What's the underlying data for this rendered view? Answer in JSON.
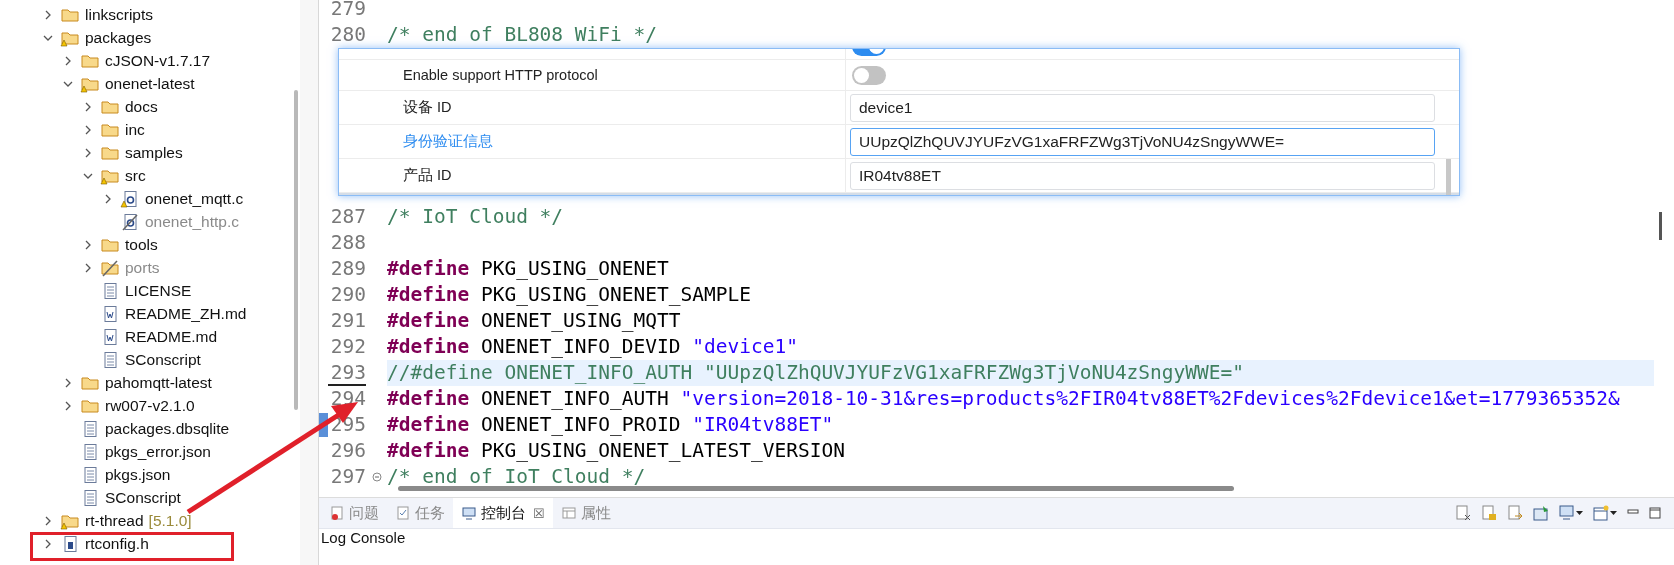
{
  "tree": [
    {
      "label": "linkscripts",
      "kind": "folder",
      "expanded": false,
      "warning": false,
      "excluded": false
    },
    {
      "label": "packages",
      "kind": "folder",
      "expanded": true,
      "warning": true,
      "excluded": false,
      "children": [
        {
          "label": "cJSON-v1.7.17",
          "kind": "folder",
          "expanded": false,
          "warning": false,
          "excluded": false
        },
        {
          "label": "onenet-latest",
          "kind": "folder",
          "expanded": true,
          "warning": true,
          "excluded": false,
          "children": [
            {
              "label": "docs",
              "kind": "folder",
              "expanded": false,
              "warning": false,
              "excluded": false
            },
            {
              "label": "inc",
              "kind": "folder",
              "expanded": false,
              "warning": false,
              "excluded": false
            },
            {
              "label": "samples",
              "kind": "folder",
              "expanded": false,
              "warning": false,
              "excluded": false
            },
            {
              "label": "src",
              "kind": "folder",
              "expanded": true,
              "warning": true,
              "excluded": false,
              "children": [
                {
                  "label": "onenet_mqtt.c",
                  "kind": "c",
                  "expanded": false,
                  "warning": true,
                  "excluded": false
                },
                {
                  "label": "onenet_http.c",
                  "kind": "c",
                  "warning": false,
                  "excluded": true
                }
              ]
            },
            {
              "label": "tools",
              "kind": "folder",
              "expanded": false,
              "warning": false,
              "excluded": false
            },
            {
              "label": "ports",
              "kind": "folder",
              "expanded": false,
              "warning": false,
              "excluded": true
            },
            {
              "label": "LICENSE",
              "kind": "file",
              "warning": false,
              "excluded": false
            },
            {
              "label": "README_ZH.md",
              "kind": "word",
              "warning": false,
              "excluded": false
            },
            {
              "label": "README.md",
              "kind": "word",
              "warning": false,
              "excluded": false
            },
            {
              "label": "SConscript",
              "kind": "file",
              "warning": false,
              "excluded": false
            }
          ]
        },
        {
          "label": "pahomqtt-latest",
          "kind": "folder",
          "expanded": false,
          "warning": false,
          "excluded": false
        },
        {
          "label": "rw007-v2.1.0",
          "kind": "folder",
          "expanded": false,
          "warning": false,
          "excluded": false
        },
        {
          "label": "packages.dbsqlite",
          "kind": "file",
          "warning": false,
          "excluded": false
        },
        {
          "label": "pkgs_error.json",
          "kind": "file",
          "warning": false,
          "excluded": false
        },
        {
          "label": "pkgs.json",
          "kind": "file",
          "warning": false,
          "excluded": false
        },
        {
          "label": "SConscript",
          "kind": "file",
          "warning": false,
          "excluded": false
        }
      ]
    },
    {
      "label": "rt-thread",
      "suffix": "[5.1.0]",
      "kind": "folder",
      "expanded": false,
      "warning": true,
      "excluded": false
    },
    {
      "label": "rtconfig.h",
      "kind": "h",
      "expanded": false,
      "warning": false,
      "excluded": false
    }
  ],
  "editor": {
    "lines_above": [
      {
        "number": "279",
        "current": false,
        "fold": false,
        "marker": false
      },
      {
        "number": "280",
        "current": false,
        "fold": false,
        "marker": false,
        "segments": [
          {
            "kind": "comment",
            "text": "/* end of BL808 WiFi */"
          }
        ]
      }
    ],
    "lines_below": [
      {
        "number": "287",
        "current": false,
        "fold": false,
        "marker": false,
        "segments": [
          {
            "kind": "comment",
            "text": "/* IoT Cloud */"
          }
        ]
      },
      {
        "number": "288",
        "current": false,
        "fold": false,
        "marker": false
      },
      {
        "number": "289",
        "current": false,
        "fold": false,
        "marker": false,
        "segments": [
          {
            "kind": "keyword",
            "text": "#define"
          },
          {
            "kind": "plain",
            "text": " PKG_USING_ONENET"
          }
        ]
      },
      {
        "number": "290",
        "current": false,
        "fold": false,
        "marker": false,
        "segments": [
          {
            "kind": "keyword",
            "text": "#define"
          },
          {
            "kind": "plain",
            "text": " PKG_USING_ONENET_SAMPLE"
          }
        ]
      },
      {
        "number": "291",
        "current": false,
        "fold": false,
        "marker": false,
        "segments": [
          {
            "kind": "keyword",
            "text": "#define"
          },
          {
            "kind": "plain",
            "text": " ONENET_USING_MQTT"
          }
        ]
      },
      {
        "number": "292",
        "current": false,
        "fold": false,
        "marker": false,
        "segments": [
          {
            "kind": "keyword",
            "text": "#define"
          },
          {
            "kind": "plain",
            "text": " ONENET_INFO_DEVID "
          },
          {
            "kind": "string",
            "text": "\"device1\""
          }
        ]
      },
      {
        "number": "293",
        "current": true,
        "fold": false,
        "marker": false,
        "segments": [
          {
            "kind": "comment",
            "text": "//#define ONENET_INFO_AUTH \"UUpzQlZhQUVJYUFzVG1xaFRFZWg3TjVoNU4zSngyWWE=\""
          }
        ]
      },
      {
        "number": "294",
        "current": false,
        "fold": false,
        "marker": false,
        "segments": [
          {
            "kind": "keyword",
            "text": "#define"
          },
          {
            "kind": "plain",
            "text": " ONENET_INFO_AUTH "
          },
          {
            "kind": "string",
            "text": "\"version=2018-10-31&res=products%2FIR04tv88ET%2Fdevices%2Fdevice1&et=1779365352&"
          }
        ]
      },
      {
        "number": "295",
        "current": false,
        "fold": false,
        "marker": true,
        "segments": [
          {
            "kind": "keyword",
            "text": "#define"
          },
          {
            "kind": "plain",
            "text": " ONENET_INFO_PROID "
          },
          {
            "kind": "string",
            "text": "\"IR04tv88ET\""
          }
        ]
      },
      {
        "number": "296",
        "current": false,
        "fold": false,
        "marker": false,
        "segments": [
          {
            "kind": "keyword",
            "text": "#define"
          },
          {
            "kind": "plain",
            "text": " PKG_USING_ONENET_LATEST_VERSION"
          }
        ]
      },
      {
        "number": "297",
        "current": false,
        "fold": true,
        "marker": false,
        "segments": [
          {
            "kind": "comment",
            "text": "/* end of IoT Cloud */"
          }
        ]
      }
    ]
  },
  "settings_popup": {
    "rows": [
      {
        "kind": "toggle",
        "on": true
      },
      {
        "kind": "toggle",
        "label": "Enable support HTTP protocol",
        "on": false
      },
      {
        "kind": "input",
        "label": "设备 ID",
        "value": "device1",
        "focused": false
      },
      {
        "kind": "input",
        "label": "身份验证信息",
        "value": "UUpzQlZhQUVJYUFzVG1xaFRFZWg3TjVoNU4zSngyWWE=",
        "focused": true
      },
      {
        "kind": "input",
        "label": "产品 ID",
        "value": "IR04tv88ET",
        "focused": false
      }
    ]
  },
  "bottom_panel": {
    "tabs": [
      {
        "label": "问题",
        "selected": false,
        "closable": false
      },
      {
        "label": "任务",
        "selected": false,
        "closable": false
      },
      {
        "label": "控制台",
        "selected": true,
        "closable": true,
        "close": "☒"
      },
      {
        "label": "属性",
        "selected": false,
        "closable": false
      }
    ],
    "console_title": "Log Console"
  }
}
